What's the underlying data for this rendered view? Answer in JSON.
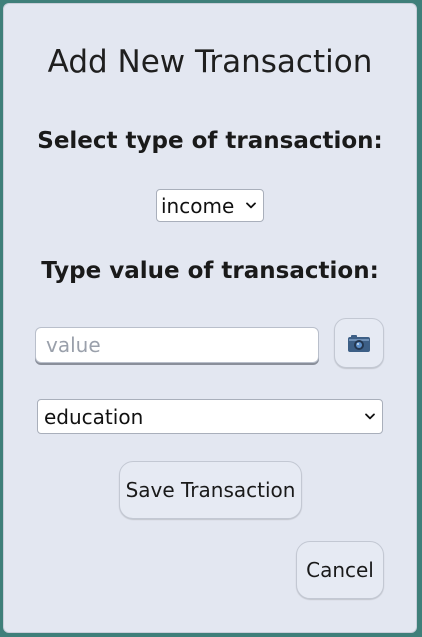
{
  "dialog": {
    "title": "Add New Transaction",
    "type_label": "Select type of transaction:",
    "type_select": {
      "selected": "income"
    },
    "value_label": "Type value of transaction:",
    "value_input": {
      "value": "",
      "placeholder": "value"
    },
    "camera_button_icon": "camera-icon",
    "category_select": {
      "selected": "education"
    },
    "save_label": "Save Transaction",
    "cancel_label": "Cancel"
  }
}
